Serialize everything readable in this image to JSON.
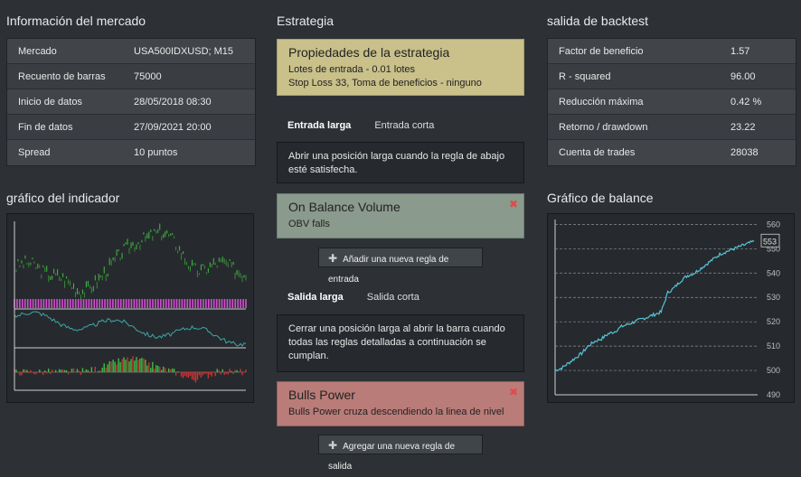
{
  "market": {
    "title": "Información del mercado",
    "rows": [
      {
        "key": "Mercado",
        "value": "USA500IDXUSD; M15"
      },
      {
        "key": "Recuento de barras",
        "value": "75000"
      },
      {
        "key": "Inicio de datos",
        "value": "28/05/2018 08:30"
      },
      {
        "key": "Fin de datos",
        "value": "27/09/2021 20:00"
      },
      {
        "key": "Spread",
        "value": "10 puntos"
      }
    ]
  },
  "indicator_chart": {
    "title": "gráfico del indicador"
  },
  "strategy": {
    "title": "Estrategia",
    "properties": {
      "title": "Propiedades de la estrategia",
      "line1": "Lotes de entrada - 0.01 lotes",
      "line2": "Stop Loss 33, Toma de beneficios - ninguno"
    },
    "entry_tabs": [
      "Entrada larga",
      "Entrada corta"
    ],
    "entry_desc": "Abrir una posición larga cuando la regla de abajo esté satisfecha.",
    "entry_rule": {
      "title": "On Balance Volume",
      "detail": "OBV falls"
    },
    "add_entry_button": "Añadir una nueva regla de entrada",
    "exit_tabs": [
      "Salida larga",
      "Salida corta"
    ],
    "exit_desc": "Cerrar una posición larga al abrir la barra cuando todas las reglas detalladas a continuación se cumplan.",
    "exit_rule": {
      "title": "Bulls Power",
      "detail": "Bulls Power cruza descendiendo la linea de nivel"
    },
    "add_exit_button": "Agregar una nueva regla de salida"
  },
  "backtest": {
    "title": "salida de backtest",
    "rows": [
      {
        "key": "Factor de beneficio",
        "value": "1.57"
      },
      {
        "key": "R - squared",
        "value": "96.00"
      },
      {
        "key": "Reducción máxima",
        "value": "0.42 %"
      },
      {
        "key": "Retorno / drawdown",
        "value": "23.22"
      },
      {
        "key": "Cuenta de trades",
        "value": "28038"
      }
    ]
  },
  "balance_chart": {
    "title": "Gráfico de balance"
  },
  "chart_data": {
    "type": "line",
    "title": "",
    "ylim": [
      490,
      562
    ],
    "yticks": [
      490,
      500,
      510,
      520,
      530,
      540,
      550,
      560
    ],
    "last_value_label": "553",
    "series": [
      {
        "values": [
          500,
          501,
          503,
          505,
          507,
          510,
          512,
          513,
          515,
          516,
          518,
          519,
          520,
          521,
          522,
          523,
          524,
          532,
          534,
          537,
          539,
          540,
          542,
          544,
          546,
          548,
          549,
          550,
          551,
          552,
          553
        ]
      }
    ]
  },
  "colors": {
    "properties_bg": "#c9c08a",
    "entry_rule_bg": "#8a9a8c",
    "exit_rule_bg": "#b97c78",
    "balance_line": "#55c4d6"
  }
}
